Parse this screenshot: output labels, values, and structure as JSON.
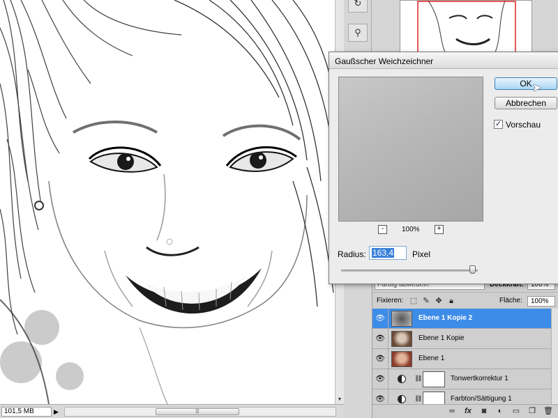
{
  "dialog": {
    "title": "Gaußscher Weichzeichner",
    "ok_label": "OK",
    "cancel_label": "Abbrechen",
    "preview_label": "Vorschau",
    "preview_checked": true,
    "zoom_minus": "-",
    "zoom_plus": "+",
    "zoom_percent": "100%",
    "radius_label": "Radius:",
    "radius_value": "163,4",
    "radius_unit": "Pixel",
    "radius_slider_fraction": 0.96
  },
  "status_bar": {
    "zoom": "101,5 MB",
    "play_icon": "play-icon"
  },
  "layers_panel": {
    "blend_mode": "Farbig abwedeln",
    "opacity_label": "Deckkraft:",
    "opacity_value": "100%",
    "lock_label": "Fixieren:",
    "lock_icons": [
      "transparency-lock-icon",
      "brush-lock-icon",
      "move-lock-icon",
      "padlock-icon"
    ],
    "fill_label": "Fläche:",
    "fill_value": "100%",
    "layers": [
      {
        "name": "Ebene 1 Kopie 2",
        "active": true,
        "kind": "pixel"
      },
      {
        "name": "Ebene 1 Kopie",
        "active": false,
        "kind": "pixel"
      },
      {
        "name": "Ebene 1",
        "active": false,
        "kind": "pixel"
      },
      {
        "name": "Tonwertkorrektur 1",
        "active": false,
        "kind": "adjustment"
      },
      {
        "name": "Farbton/Sättigung 1",
        "active": false,
        "kind": "adjustment"
      }
    ],
    "bottom_icons": [
      "link-icon",
      "fx-icon",
      "mask-icon",
      "adjustment-icon",
      "folder-icon",
      "new-layer-icon",
      "trash-icon"
    ]
  },
  "colors": {
    "active_layer": "#3d8ce8",
    "ok_button": "#a9d6f5",
    "radius_highlight": "#3a80d9"
  }
}
